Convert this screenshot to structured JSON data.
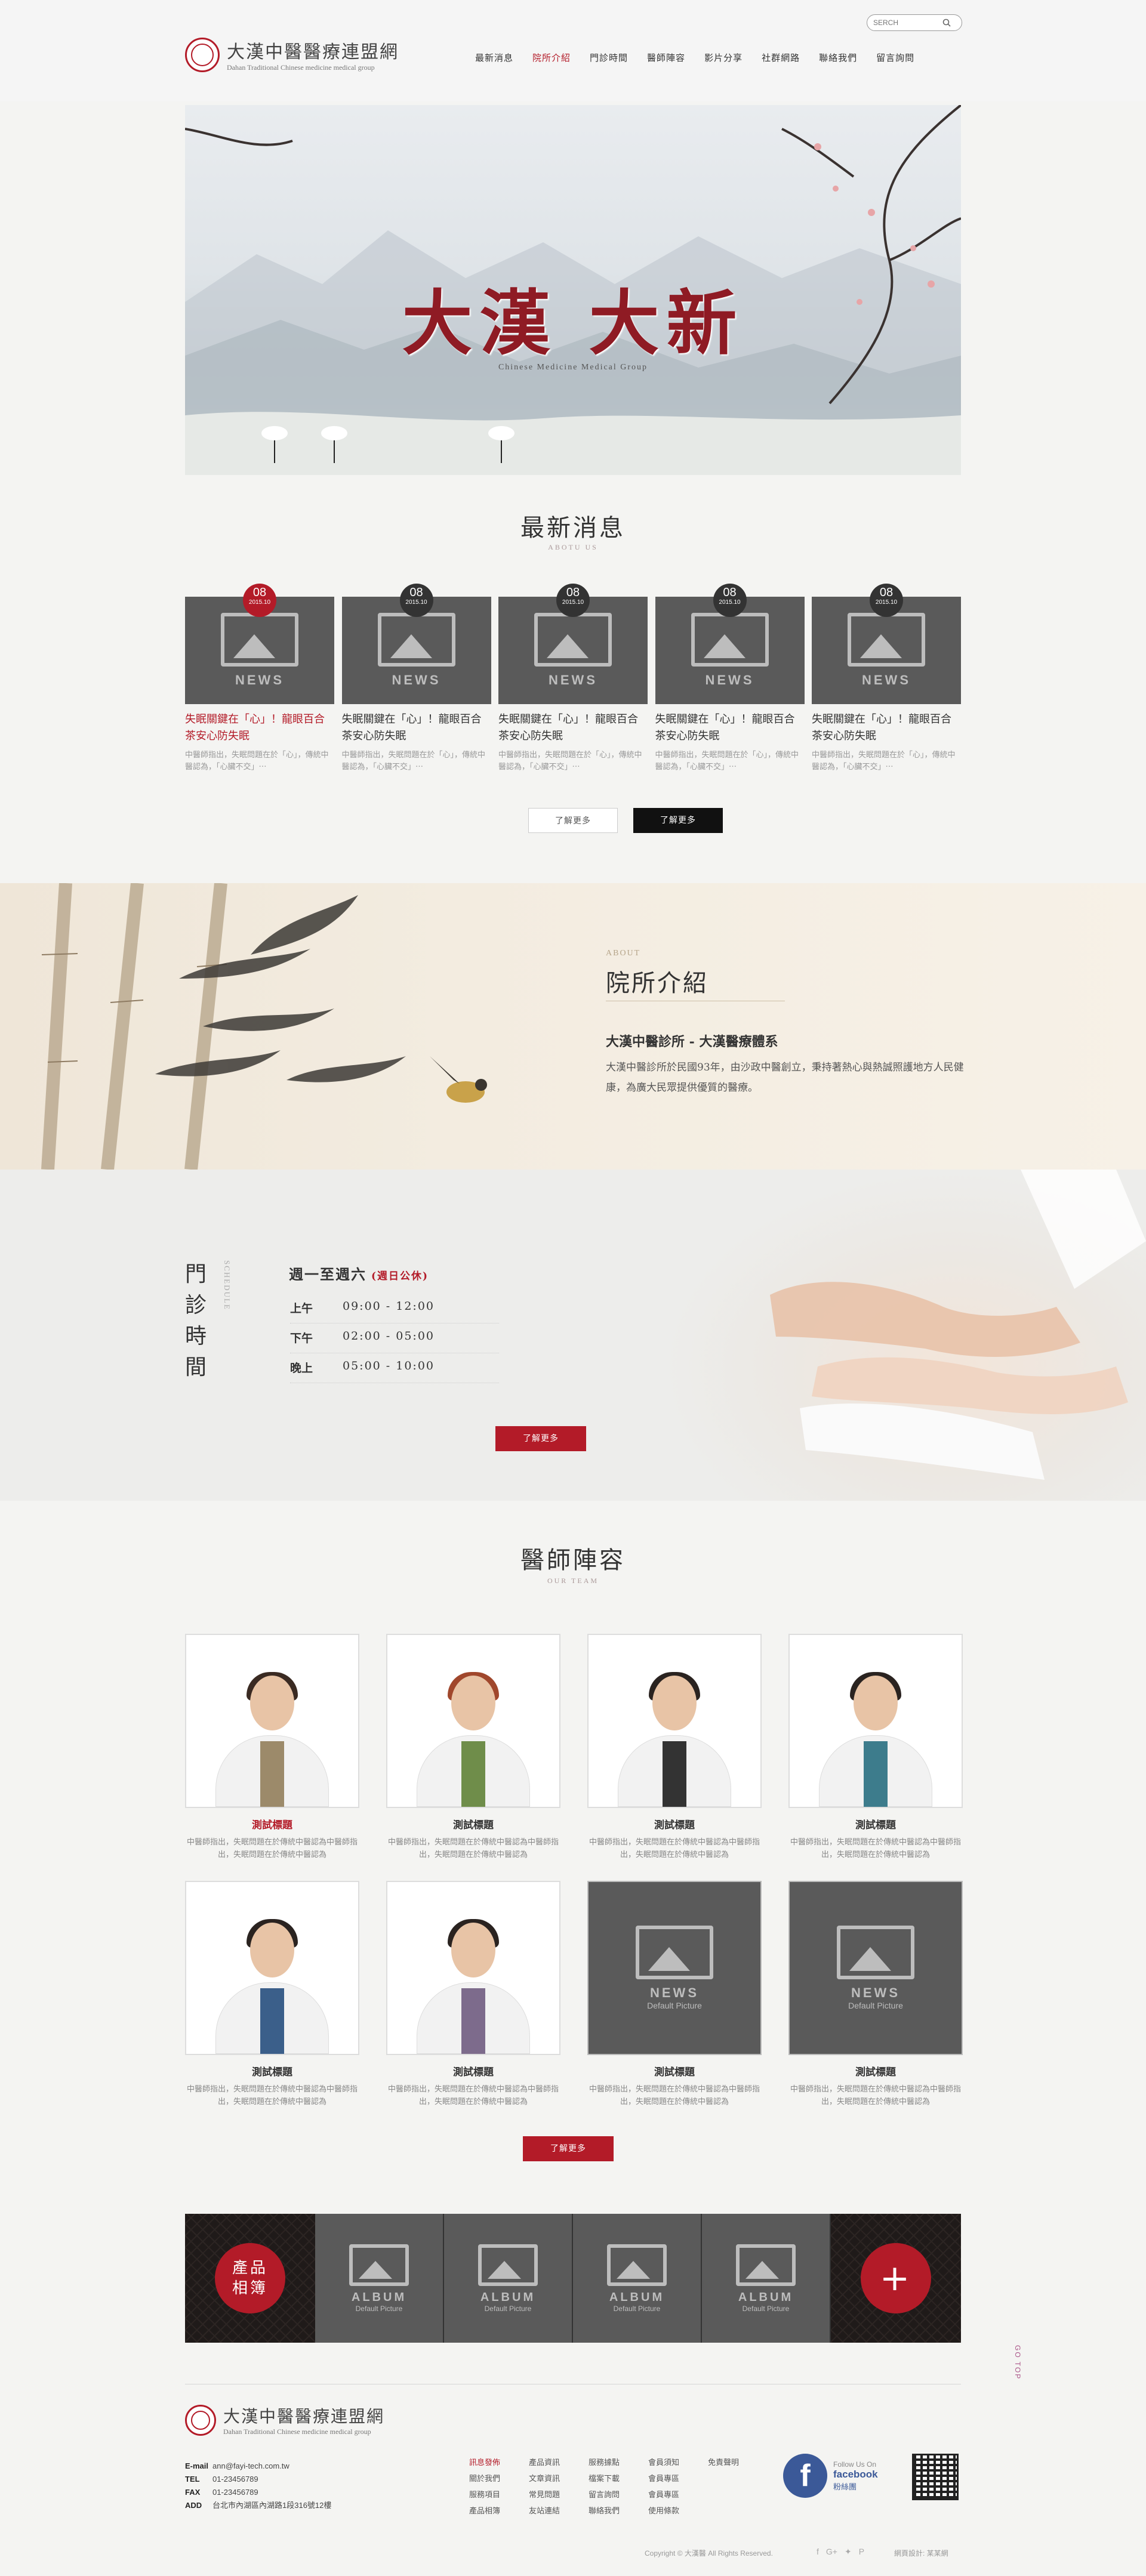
{
  "brand": {
    "name": "大漢中醫醫療連盟網",
    "subtitle": "Dahan Traditional Chinese medicine medical group"
  },
  "nav": [
    "最新消息",
    "院所介紹",
    "門診時間",
    "醫師陣容",
    "影片分享",
    "社群網路",
    "聯絡我們",
    "留言詢問"
  ],
  "search": {
    "placeholder": "SERCH"
  },
  "banner": {
    "title": "大漢 大新",
    "subtitle": "Chinese Medicine Medical Group"
  },
  "news": {
    "title": "最新消息",
    "subtitle": "ABOTU US",
    "items": [
      {
        "day": "08",
        "month": "2015.10",
        "label": "NEWS",
        "title": "失眠關鍵在「心」！龍眼百合茶安心防失眠",
        "desc": "中醫師指出，失眠問題在於「心」，傳統中醫認為，「心臟不交」⋯"
      },
      {
        "day": "08",
        "month": "2015.10",
        "label": "NEWS",
        "title": "失眠關鍵在「心」！龍眼百合茶安心防失眠",
        "desc": "中醫師指出，失眠問題在於「心」，傳統中醫認為，「心臟不交」⋯"
      },
      {
        "day": "08",
        "month": "2015.10",
        "label": "NEWS",
        "title": "失眠關鍵在「心」！龍眼百合茶安心防失眠",
        "desc": "中醫師指出，失眠問題在於「心」，傳統中醫認為，「心臟不交」⋯"
      },
      {
        "day": "08",
        "month": "2015.10",
        "label": "NEWS",
        "title": "失眠關鍵在「心」！龍眼百合茶安心防失眠",
        "desc": "中醫師指出，失眠問題在於「心」，傳統中醫認為，「心臟不交」⋯"
      },
      {
        "day": "08",
        "month": "2015.10",
        "label": "NEWS",
        "title": "失眠關鍵在「心」！龍眼百合茶安心防失眠",
        "desc": "中醫師指出，失眠問題在於「心」，傳統中醫認為，「心臟不交」⋯"
      }
    ],
    "btn_more_light": "了解更多",
    "btn_more_dark": "了解更多"
  },
  "about": {
    "en": "ABOUT",
    "title": "院所介紹",
    "heading": "大漢中醫診所 - 大漢醫療體系",
    "body": "大漢中醫診所於民國93年，由沙政中醫創立，秉持著熱心與熱誠照護地方人民健康，為廣大民眾提供優質的醫療。"
  },
  "hours": {
    "title_vertical": "門診時間",
    "en": "SCHEDULE",
    "heading": "週一至週六",
    "note": "(週日公休)",
    "rows": [
      {
        "k": "上午",
        "v": "09:00 - 12:00"
      },
      {
        "k": "下午",
        "v": "02:00 - 05:00"
      },
      {
        "k": "晚上",
        "v": "05:00 - 10:00"
      }
    ],
    "btn": "了解更多"
  },
  "team": {
    "title": "醫師陣容",
    "subtitle": "OUR TEAM",
    "doctors": [
      {
        "name": "測試標題",
        "desc": "中醫師指出，失眠問題在於傳統中醫認為中醫師指出，失眠問題在於傳統中醫認為"
      },
      {
        "name": "測試標題",
        "desc": "中醫師指出，失眠問題在於傳統中醫認為中醫師指出，失眠問題在於傳統中醫認為"
      },
      {
        "name": "測試標題",
        "desc": "中醫師指出，失眠問題在於傳統中醫認為中醫師指出，失眠問題在於傳統中醫認為"
      },
      {
        "name": "測試標題",
        "desc": "中醫師指出，失眠問題在於傳統中醫認為中醫師指出，失眠問題在於傳統中醫認為"
      },
      {
        "name": "測試標題",
        "desc": "中醫師指出，失眠問題在於傳統中醫認為中醫師指出，失眠問題在於傳統中醫認為"
      },
      {
        "name": "測試標題",
        "desc": "中醫師指出，失眠問題在於傳統中醫認為中醫師指出，失眠問題在於傳統中醫認為"
      },
      {
        "name": "測試標題",
        "desc": "中醫師指出，失眠問題在於傳統中醫認為中醫師指出，失眠問題在於傳統中醫認為",
        "ph1": "NEWS",
        "ph2": "Default Picture"
      },
      {
        "name": "測試標題",
        "desc": "中醫師指出，失眠問題在於傳統中醫認為中醫師指出，失眠問題在於傳統中醫認為",
        "ph1": "NEWS",
        "ph2": "Default Picture"
      }
    ],
    "btn": "了解更多"
  },
  "album": {
    "label": "產品相簿",
    "items": [
      {
        "l1": "ALBUM",
        "l2": "Default Picture"
      },
      {
        "l1": "ALBUM",
        "l2": "Default Picture"
      },
      {
        "l1": "ALBUM",
        "l2": "Default Picture"
      },
      {
        "l1": "ALBUM",
        "l2": "Default Picture"
      }
    ],
    "plus": "+"
  },
  "footer": {
    "contact": [
      {
        "k": "E-mail",
        "v": "ann@fayi-tech.com.tw"
      },
      {
        "k": "TEL",
        "v": "01-23456789"
      },
      {
        "k": "FAX",
        "v": "01-23456789"
      },
      {
        "k": "ADD",
        "v": "台北市內湖區內湖路1段316號12樓"
      }
    ],
    "links": [
      "訊息發佈",
      "產品資訊",
      "服務據點",
      "會員須知",
      "免責聲明",
      "關於我們",
      "文章資訊",
      "檔案下載",
      "會員專區",
      "",
      "服務項目",
      "常見問題",
      "留言詢問",
      "會員專區",
      "",
      "產品相簿",
      "友站連結",
      "聯絡我們",
      "使用條款",
      ""
    ],
    "fb_follow": "Follow Us On",
    "fb_name": "facebook",
    "fb_sub": "粉絲團",
    "copyright": "Copyright © 大漢醫 All Rights Reserved.",
    "design": "網頁設計: 某某網",
    "gotop": "GO TOP"
  },
  "colors": {
    "accent": "#b31b28",
    "dark": "#111111",
    "bg": "#f4f4f2"
  }
}
